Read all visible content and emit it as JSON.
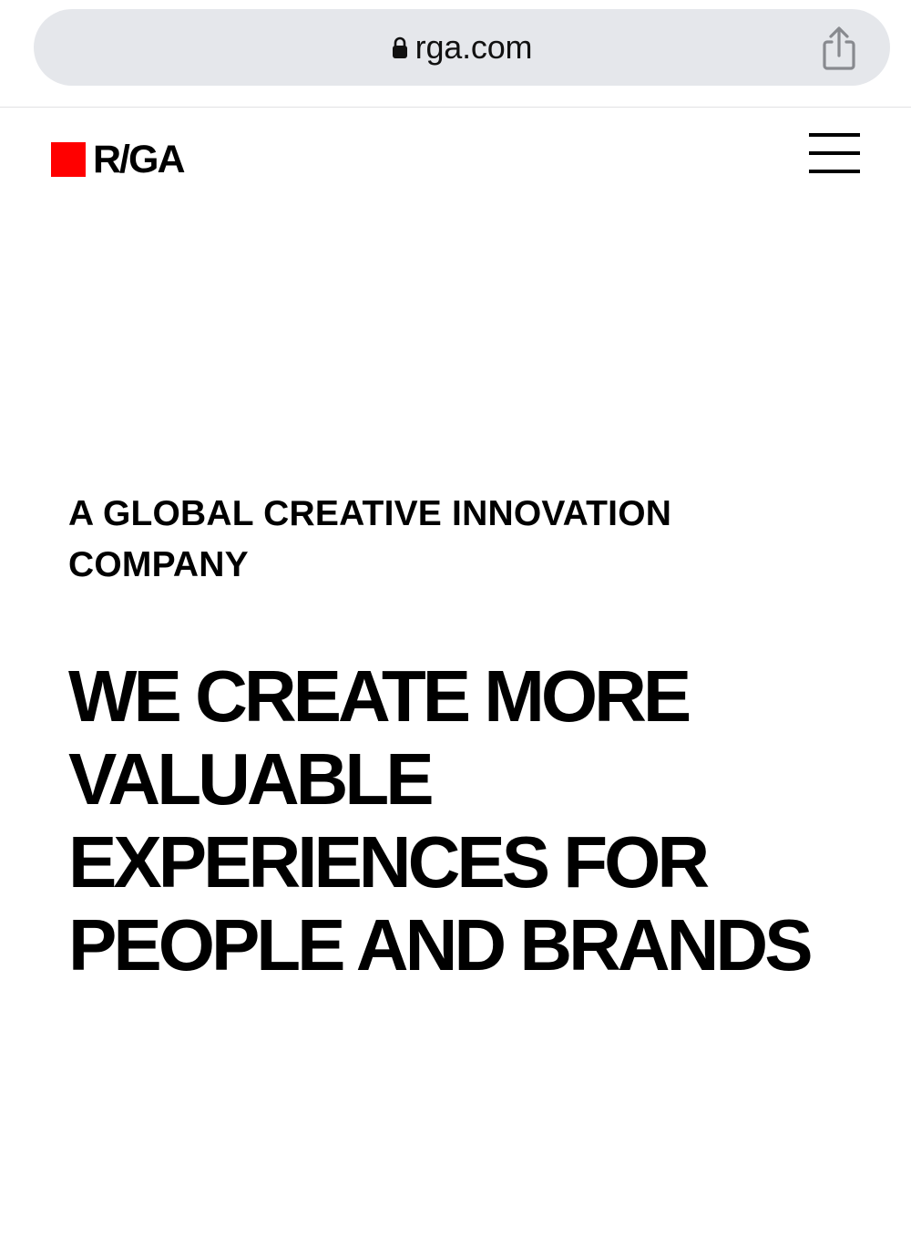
{
  "browser": {
    "url": "rga.com",
    "lock_icon": "lock-icon",
    "share_icon": "share-icon"
  },
  "header": {
    "logo_text": "R/GA",
    "logo_color": "#ff0000",
    "menu_icon": "hamburger-menu-icon"
  },
  "hero": {
    "tagline": "A GLOBAL CREATIVE INNOVATION COMPANY",
    "headline": "WE CREATE MORE VALUABLE EXPERIENCES FOR PEOPLE AND BRANDS"
  }
}
